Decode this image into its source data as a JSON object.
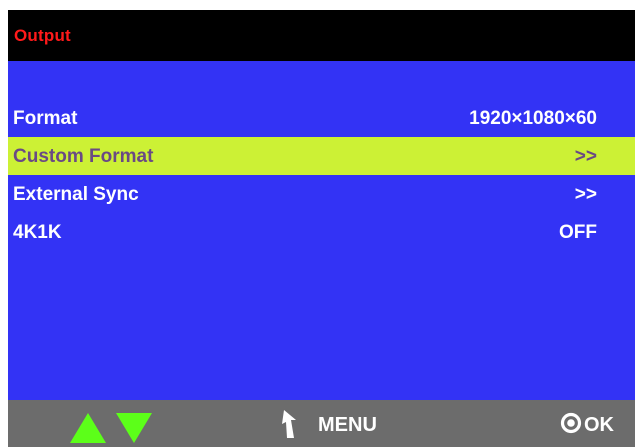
{
  "title": "Output",
  "menu": {
    "items": [
      {
        "label": "Format",
        "value": "1920×1080×60",
        "selected": false
      },
      {
        "label": "Custom Format",
        "value": ">>",
        "selected": true
      },
      {
        "label": "External Sync",
        "value": ">>",
        "selected": false
      },
      {
        "label": "4K1K",
        "value": "OFF",
        "selected": false
      }
    ]
  },
  "footer": {
    "up_icon": "triangle-up-icon",
    "down_icon": "triangle-down-icon",
    "menu_icon": "back-arrow-icon",
    "menu_label": "MENU",
    "ok_icon": "ring-dot-icon",
    "ok_label": "OK"
  },
  "colors": {
    "background": "#3333f5",
    "title_bar": "#000000",
    "title_text": "#ff1a1a",
    "selected_row": "#ccf135",
    "selected_text": "#6a4a84",
    "footer": "#6c6c6c",
    "nav_arrows": "#5cff19"
  }
}
